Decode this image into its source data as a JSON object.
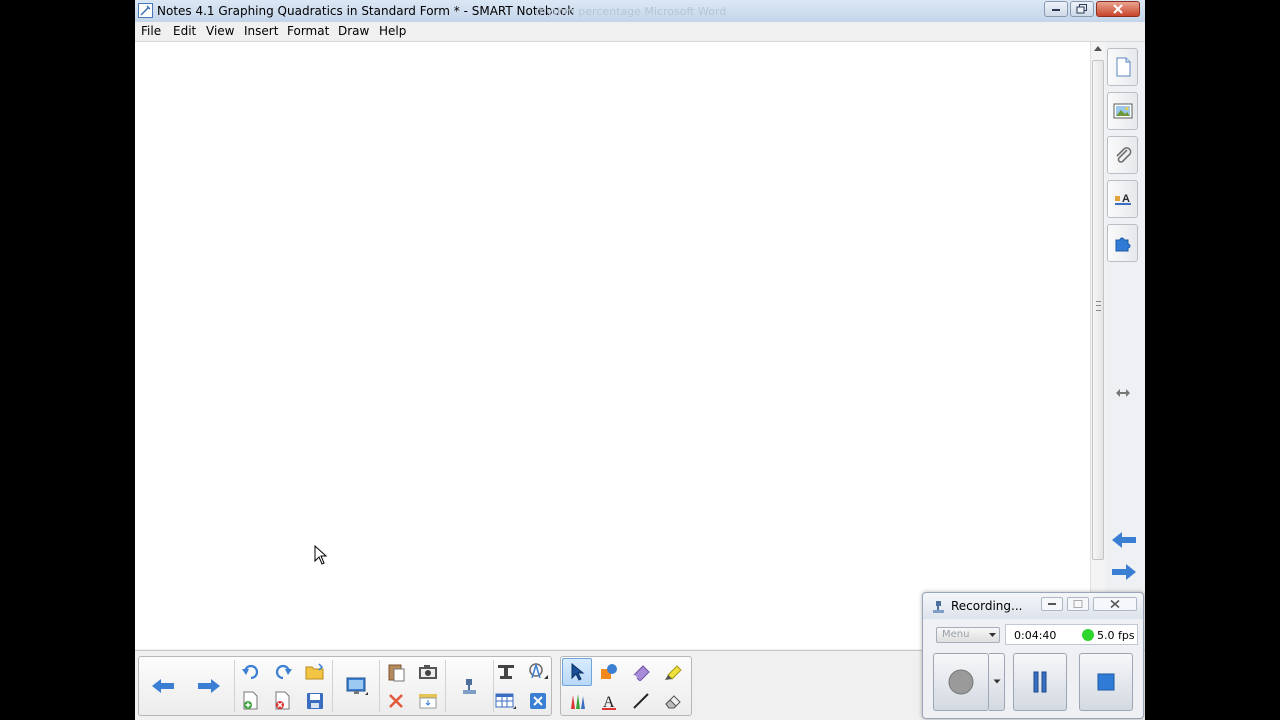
{
  "window": {
    "title": "Notes 4.1 Graphing Quadratics in Standard Form * - SMART Notebook",
    "ghost_title": "rhythm percentage      Microsoft Word"
  },
  "menu": {
    "items": [
      "File",
      "Edit",
      "View",
      "Insert",
      "Format",
      "Draw",
      "Help"
    ]
  },
  "side_panel": {
    "tabs": [
      {
        "icon": "page-sorter-icon"
      },
      {
        "icon": "gallery-icon"
      },
      {
        "icon": "attachments-icon"
      },
      {
        "icon": "properties-icon"
      },
      {
        "icon": "add-ons-icon"
      }
    ]
  },
  "toolbar": {
    "nav_buttons": [
      "previous-page",
      "next-page",
      "undo",
      "redo",
      "open-file",
      "add-page",
      "delete-page",
      "save",
      "display-screen",
      "paste",
      "delete",
      "screen-capture",
      "screen-shade",
      "document-camera",
      "full-screen",
      "insert-table",
      "measurement-tools",
      "close"
    ],
    "tool_buttons": [
      "select",
      "shapes",
      "magic-pen",
      "highlighter",
      "pens",
      "text",
      "lines",
      "eraser"
    ],
    "selected_tool": "select"
  },
  "recorder": {
    "title": "Recording...",
    "menu_label": "Menu",
    "elapsed": "0:04:40",
    "fps": "5.0 fps",
    "status_color": "#2ed52e"
  },
  "colors": {
    "accent": "#3b7fd4",
    "canvas": "#ffffff",
    "chrome": "#f0f0f0"
  }
}
